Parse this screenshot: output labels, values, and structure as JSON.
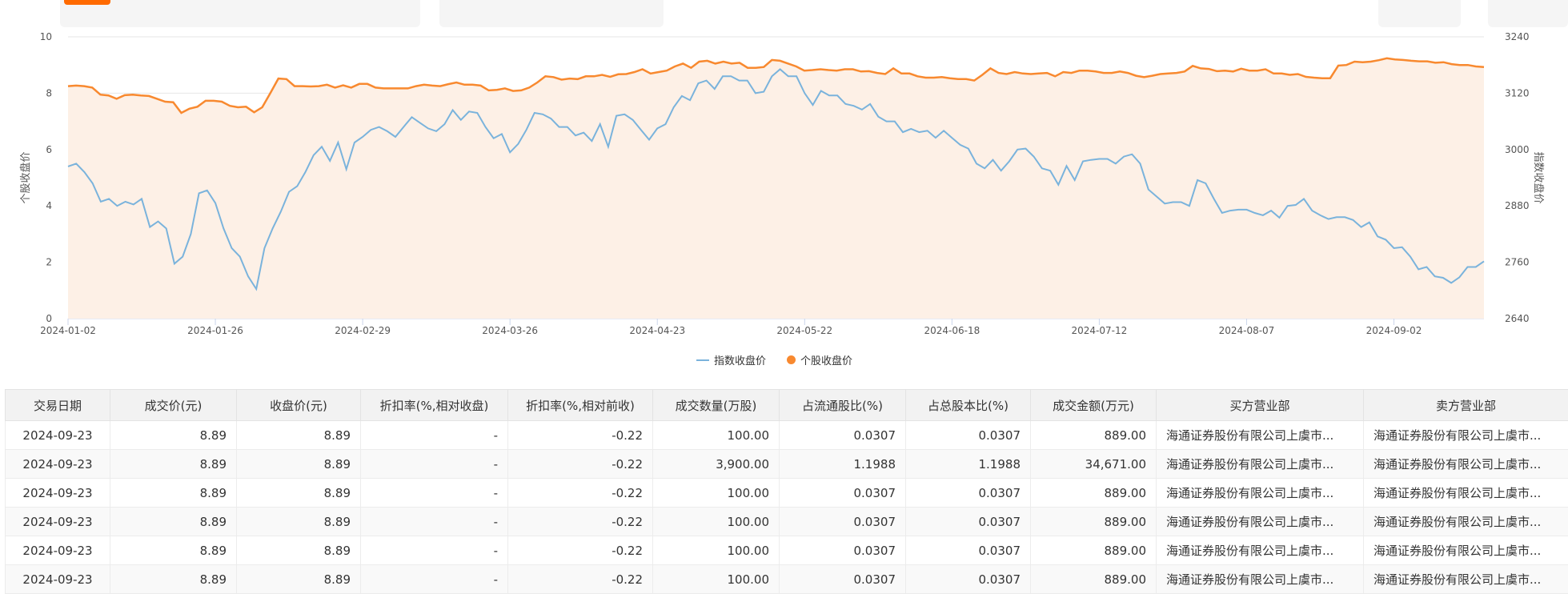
{
  "chart_data": {
    "type": "line",
    "legend_position": "bottom",
    "grid": true,
    "left_axis": {
      "label": "个股收盘价",
      "range": [
        0,
        10
      ],
      "ticks": [
        "0",
        "2",
        "4",
        "6",
        "8",
        "10"
      ]
    },
    "right_axis": {
      "label": "指数收盘价",
      "range": [
        2640,
        3240
      ],
      "ticks": [
        "2640",
        "2760",
        "2880",
        "3000",
        "3120",
        "3240"
      ]
    },
    "x_ticks": [
      "2024-01-02",
      "2024-01-26",
      "2024-02-29",
      "2024-03-26",
      "2024-04-23",
      "2024-05-22",
      "2024-06-18",
      "2024-07-12",
      "2024-08-07",
      "2024-09-02"
    ],
    "tick_every": 18,
    "colors": {
      "index": "#7ab3dc",
      "stock": "#f8892f",
      "area": "#fdf0e6"
    },
    "series": [
      {
        "name": "指数收盘价",
        "axis": "right",
        "values": [
          2964,
          2970,
          2952,
          2928,
          2889,
          2895,
          2880,
          2889,
          2883,
          2895,
          2835,
          2847,
          2832,
          2757,
          2772,
          2820,
          2907,
          2913,
          2886,
          2832,
          2790,
          2772,
          2730,
          2703,
          2790,
          2832,
          2868,
          2910,
          2922,
          2952,
          2988,
          3006,
          2976,
          3015,
          2958,
          3015,
          3027,
          3042,
          3048,
          3039,
          3027,
          3048,
          3069,
          3057,
          3045,
          3039,
          3054,
          3084,
          3063,
          3081,
          3078,
          3048,
          3024,
          3033,
          2994,
          3012,
          3042,
          3078,
          3075,
          3066,
          3048,
          3048,
          3030,
          3036,
          3018,
          3054,
          3006,
          3072,
          3075,
          3063,
          3042,
          3021,
          3045,
          3054,
          3090,
          3114,
          3105,
          3141,
          3147,
          3129,
          3156,
          3156,
          3147,
          3147,
          3120,
          3123,
          3156,
          3171,
          3156,
          3156,
          3120,
          3095,
          3125,
          3115,
          3115,
          3097,
          3093,
          3085,
          3097,
          3070,
          3060,
          3060,
          3037,
          3044,
          3037,
          3040,
          3025,
          3040,
          3025,
          3010,
          3002,
          2970,
          2960,
          2978,
          2955,
          2975,
          3000,
          3002,
          2985,
          2960,
          2955,
          2925,
          2965,
          2935,
          2975,
          2978,
          2980,
          2980,
          2970,
          2985,
          2990,
          2970,
          2915,
          2900,
          2885,
          2888,
          2888,
          2880,
          2935,
          2928,
          2895,
          2865,
          2870,
          2872,
          2872,
          2865,
          2860,
          2870,
          2855,
          2880,
          2882,
          2895,
          2870,
          2860,
          2852,
          2856,
          2856,
          2850,
          2835,
          2845,
          2815,
          2808,
          2790,
          2792,
          2772,
          2745,
          2750,
          2730,
          2727,
          2716,
          2728,
          2750,
          2750,
          2762
        ]
      },
      {
        "name": "个股收盘价",
        "axis": "left",
        "values": [
          8.25,
          8.27,
          8.25,
          8.2,
          7.95,
          7.92,
          7.8,
          7.93,
          7.95,
          7.92,
          7.9,
          7.8,
          7.7,
          7.68,
          7.3,
          7.45,
          7.52,
          7.73,
          7.73,
          7.7,
          7.55,
          7.5,
          7.52,
          7.32,
          7.5,
          8.0,
          8.52,
          8.5,
          8.25,
          8.25,
          8.24,
          8.25,
          8.3,
          8.2,
          8.28,
          8.2,
          8.33,
          8.33,
          8.2,
          8.17,
          8.17,
          8.17,
          8.17,
          8.25,
          8.3,
          8.27,
          8.25,
          8.32,
          8.38,
          8.3,
          8.3,
          8.27,
          8.1,
          8.12,
          8.17,
          8.08,
          8.1,
          8.2,
          8.38,
          8.6,
          8.57,
          8.48,
          8.52,
          8.5,
          8.6,
          8.6,
          8.65,
          8.58,
          8.67,
          8.68,
          8.75,
          8.85,
          8.7,
          8.75,
          8.8,
          8.95,
          9.05,
          8.9,
          9.12,
          9.15,
          9.05,
          9.12,
          9.05,
          9.08,
          8.9,
          8.9,
          8.93,
          9.18,
          9.15,
          9.05,
          8.95,
          8.8,
          8.82,
          8.85,
          8.82,
          8.8,
          8.85,
          8.85,
          8.77,
          8.78,
          8.72,
          8.68,
          8.88,
          8.7,
          8.7,
          8.6,
          8.55,
          8.55,
          8.57,
          8.53,
          8.5,
          8.5,
          8.45,
          8.65,
          8.88,
          8.72,
          8.68,
          8.75,
          8.7,
          8.68,
          8.7,
          8.72,
          8.6,
          8.75,
          8.72,
          8.8,
          8.8,
          8.77,
          8.72,
          8.72,
          8.77,
          8.72,
          8.62,
          8.57,
          8.62,
          8.68,
          8.7,
          8.72,
          8.77,
          8.97,
          8.88,
          8.86,
          8.78,
          8.8,
          8.77,
          8.87,
          8.8,
          8.8,
          8.85,
          8.7,
          8.7,
          8.65,
          8.68,
          8.58,
          8.55,
          8.53,
          8.53,
          8.98,
          9.0,
          9.12,
          9.1,
          9.12,
          9.17,
          9.24,
          9.2,
          9.18,
          9.15,
          9.13,
          9.13,
          9.08,
          9.1,
          9.03,
          9.0,
          9.0,
          8.95,
          8.93
        ]
      }
    ]
  },
  "table": {
    "headers": [
      "交易日期",
      "成交价(元)",
      "收盘价(元)",
      "折扣率(%,相对收盘)",
      "折扣率(%,相对前收)",
      "成交数量(万股)",
      "占流通股比(%)",
      "占总股本比(%)",
      "成交金额(万元)",
      "买方营业部",
      "卖方营业部"
    ],
    "rows": [
      [
        "2024-09-23",
        "8.89",
        "8.89",
        "-",
        "-0.22",
        "100.00",
        "0.0307",
        "0.0307",
        "889.00",
        "海通证券股份有限公司上虞市...",
        "海通证券股份有限公司上虞市..."
      ],
      [
        "2024-09-23",
        "8.89",
        "8.89",
        "-",
        "-0.22",
        "3,900.00",
        "1.1988",
        "1.1988",
        "34,671.00",
        "海通证券股份有限公司上虞市...",
        "海通证券股份有限公司上虞市..."
      ],
      [
        "2024-09-23",
        "8.89",
        "8.89",
        "-",
        "-0.22",
        "100.00",
        "0.0307",
        "0.0307",
        "889.00",
        "海通证券股份有限公司上虞市...",
        "海通证券股份有限公司上虞市..."
      ],
      [
        "2024-09-23",
        "8.89",
        "8.89",
        "-",
        "-0.22",
        "100.00",
        "0.0307",
        "0.0307",
        "889.00",
        "海通证券股份有限公司上虞市...",
        "海通证券股份有限公司上虞市..."
      ],
      [
        "2024-09-23",
        "8.89",
        "8.89",
        "-",
        "-0.22",
        "100.00",
        "0.0307",
        "0.0307",
        "889.00",
        "海通证券股份有限公司上虞市...",
        "海通证券股份有限公司上虞市..."
      ],
      [
        "2024-09-23",
        "8.89",
        "8.89",
        "-",
        "-0.22",
        "100.00",
        "0.0307",
        "0.0307",
        "889.00",
        "海通证券股份有限公司上虞市...",
        "海通证券股份有限公司上虞市..."
      ]
    ]
  }
}
